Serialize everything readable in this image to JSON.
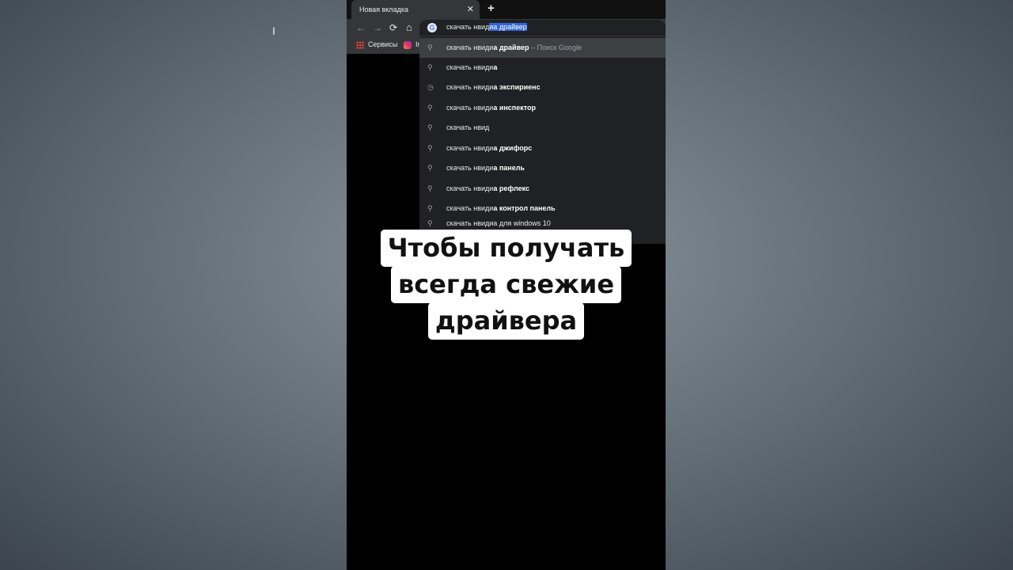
{
  "tab": {
    "title": "Новая вкладка",
    "close": "✕",
    "new_tab": "+"
  },
  "toolbar": {
    "back_icon": "←",
    "forward_icon": "→",
    "reload_icon": "⟳",
    "home_icon": "⌂",
    "omnibox": {
      "typed": "скачать нвид",
      "selected": "иа драйвер"
    }
  },
  "bookmarks": [
    {
      "label": "Сервисы",
      "icon": "apps-grid-icon"
    },
    {
      "label": "In",
      "icon": "instagram-icon"
    }
  ],
  "suggestions": [
    {
      "icon": "search-icon",
      "plain": "скачать нвиди",
      "bold": "а драйвер",
      "hint": " – Поиск Google"
    },
    {
      "icon": "search-icon",
      "plain": "скачать нвиди",
      "bold": "а",
      "hint": ""
    },
    {
      "icon": "history-icon",
      "plain": "скачать нвиди",
      "bold": "а экспириенс",
      "hint": ""
    },
    {
      "icon": "search-icon",
      "plain": "скачать нвиди",
      "bold": "а инспектор",
      "hint": ""
    },
    {
      "icon": "search-icon",
      "plain": "скачать нвид",
      "bold": "",
      "hint": ""
    },
    {
      "icon": "search-icon",
      "plain": "скачать нвиди",
      "bold": "а джифорс",
      "hint": ""
    },
    {
      "icon": "search-icon",
      "plain": "скачать нвиди",
      "bold": "а панель",
      "hint": ""
    },
    {
      "icon": "search-icon",
      "plain": "скачать нвиди",
      "bold": "а рефлекс",
      "hint": ""
    },
    {
      "icon": "search-icon",
      "plain": "скачать нвиди",
      "bold": "а контрол панель",
      "hint": ""
    },
    {
      "icon": "search-icon",
      "plain": "скачать нвидиа для windows 10",
      "bold": "",
      "hint": ""
    }
  ],
  "caption": {
    "line1": "Чтобы получать",
    "line2": "всегда свежие",
    "line3": "драйвера"
  },
  "colors": {
    "background": "#5f6a73",
    "browser_dark": "#202124",
    "selection": "#3367d6"
  }
}
